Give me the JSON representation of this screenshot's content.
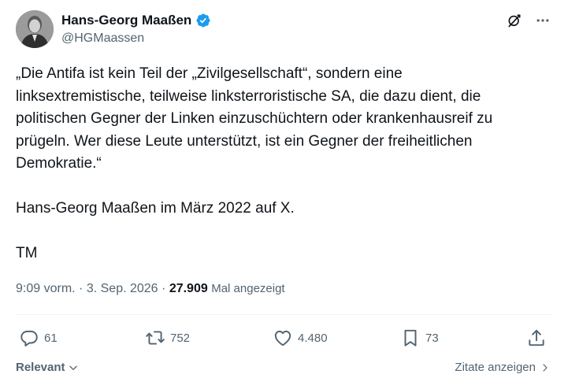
{
  "author": {
    "display_name": "Hans-Georg Maaßen",
    "handle": "@HGMaassen",
    "verified": true,
    "avatar_icon": "person-portrait"
  },
  "header_icons": [
    "grok-icon",
    "more-options-icon"
  ],
  "tweet": {
    "lines": [
      "„Die Antifa ist kein Teil der „Zivilgesellschaft“, sondern eine",
      "linksextremistische, teilweise linksterroristische SA, die dazu dient, die",
      "politischen Gegner der Linken einzuschüchtern oder krankenhausreif zu",
      "prügeln. Wer diese Leute unterstützt, ist ein Gegner der freiheitlichen",
      "Demokratie.“"
    ],
    "line2": "Hans-Georg Maaßen im März 2022 auf X.",
    "signature": "TM"
  },
  "meta": {
    "time": "9:09 vorm.",
    "date": "3. Sep. 2026",
    "views": "27.909",
    "views_label": "Mal angezeigt"
  },
  "actions": {
    "replies": "61",
    "reposts": "752",
    "likes": "4.480",
    "bookmarks": "73"
  },
  "footer": {
    "sort_label": "Relevant",
    "quotes_label": "Zitate anzeigen"
  },
  "colors": {
    "text": "#0f1419",
    "secondary": "#536471",
    "verified_blue": "#1d9bf0",
    "divider": "#eff3f4"
  }
}
